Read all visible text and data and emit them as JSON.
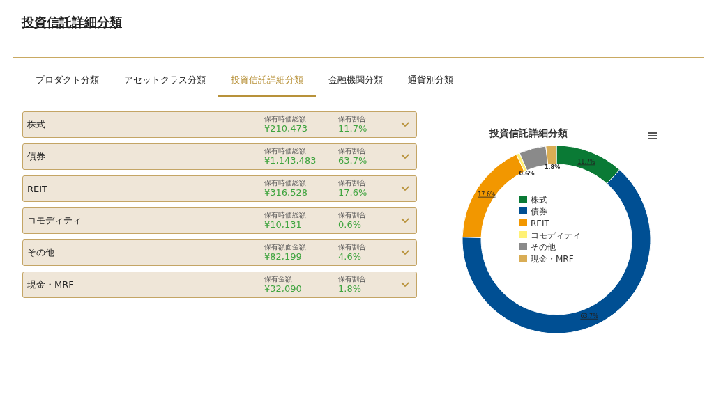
{
  "page_title": "投資信託詳細分類",
  "tabs": [
    {
      "label": "プロダクト分類",
      "selected": false
    },
    {
      "label": "アセットクラス分類",
      "selected": false
    },
    {
      "label": "投資信託詳細分類",
      "selected": true
    },
    {
      "label": "金融機関分類",
      "selected": false
    },
    {
      "label": "通貨別分類",
      "selected": false
    }
  ],
  "rows": [
    {
      "name": "株式",
      "amount_label": "保有時価総額",
      "amount": "¥210,473",
      "share_label": "保有割合",
      "share": "11.7%",
      "expanded": false
    },
    {
      "name": "債券",
      "amount_label": "保有時価総額",
      "amount": "¥1,143,483",
      "share_label": "保有割合",
      "share": "63.7%",
      "expanded": false
    },
    {
      "name": "REIT",
      "amount_label": "保有時価総額",
      "amount": "¥316,528",
      "share_label": "保有割合",
      "share": "17.6%",
      "expanded": false
    },
    {
      "name": "コモディティ",
      "amount_label": "保有時価総額",
      "amount": "¥10,131",
      "share_label": "保有割合",
      "share": "0.6%",
      "expanded": false
    },
    {
      "name": "その他",
      "amount_label": "保有額面金額",
      "amount": "¥82,199",
      "share_label": "保有割合",
      "share": "4.6%",
      "expanded": false
    },
    {
      "name": "現金・MRF",
      "amount_label": "保有金額",
      "amount": "¥32,090",
      "share_label": "保有割合",
      "share": "1.8%",
      "expanded": false
    }
  ],
  "chart": {
    "chart_data": {
      "type": "donut",
      "title": "投資信託詳細分類",
      "categories": [
        "株式",
        "債券",
        "REIT",
        "コモディティ",
        "その他",
        "現金・MRF"
      ],
      "values": [
        11.7,
        63.7,
        17.6,
        0.6,
        4.6,
        1.8
      ],
      "colors": [
        "#0a7a35",
        "#004f93",
        "#f29700",
        "#fff176",
        "#8a8a8a",
        "#d9ad55"
      ],
      "legend": true,
      "value_labels": [
        "11.7%",
        "63.7%",
        "17.6%",
        "0.6%",
        null,
        "1.8%"
      ]
    }
  }
}
